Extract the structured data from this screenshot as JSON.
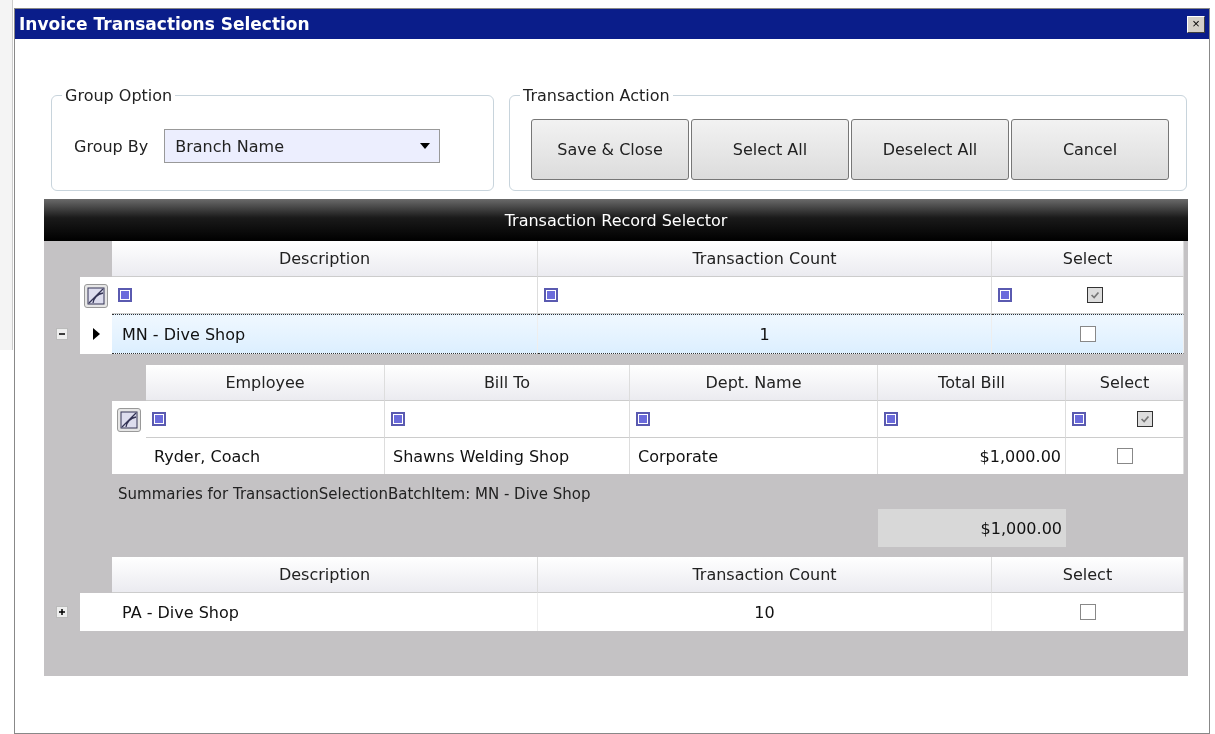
{
  "window": {
    "title": "Invoice Transactions Selection",
    "close": "×"
  },
  "group_option": {
    "legend": "Group Option",
    "label": "Group By",
    "value": "Branch Name"
  },
  "transaction_action": {
    "legend": "Transaction Action",
    "buttons": [
      "Save & Close",
      "Select All",
      "Deselect All",
      "Cancel"
    ]
  },
  "grid": {
    "title": "Transaction Record Selector",
    "filter_select_checked": true,
    "groups": [
      {
        "header_columns": [
          "Description",
          "Transaction Count",
          "Select"
        ],
        "description": "MN - Dive Shop",
        "count": "1",
        "checked": false,
        "expanded": true,
        "current": true,
        "detail": {
          "columns": [
            "Employee",
            "Bill To",
            "Dept. Name",
            "Total Bill",
            "Select"
          ],
          "filter_select_checked": true,
          "rows": [
            {
              "employee": "Ryder, Coach",
              "bill_to": "Shawns Welding Shop",
              "dept": "Corporate",
              "total": "$1,000.00",
              "checked": false
            }
          ],
          "summary_label": "Summaries for TransactionSelectionBatchItem: MN - Dive Shop",
          "summary_total": "$1,000.00"
        }
      },
      {
        "header_columns": [
          "Description",
          "Transaction Count",
          "Select"
        ],
        "description": "PA - Dive Shop",
        "count": "10",
        "checked": false,
        "expanded": false,
        "current": false
      }
    ]
  }
}
